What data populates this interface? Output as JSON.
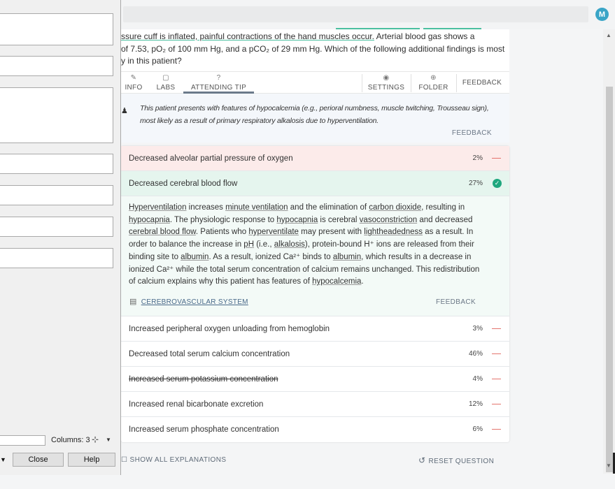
{
  "app": {
    "user_initial": "M",
    "accent": "#4bbfa0"
  },
  "stem": {
    "line1_a": "ssure cuff is inflated, painful contractions of the hand muscles occur.",
    "line1_b": " Arterial blood gas shows a",
    "line2": "of 7.53, pO₂ of 100 mm Hg, and a pCO₂ of 29 mm Hg. Which of the following additional findings is most",
    "line3": "y in this patient?"
  },
  "tabs": {
    "info": "INFO",
    "labs": "LABS",
    "attending_tip": "ATTENDING TIP",
    "settings": "SETTINGS",
    "folder": "FOLDER",
    "feedback": "FEEDBACK"
  },
  "tip": {
    "text": "This patient presents with features of hypocalcemia (e.g., perioral numbness, muscle twitching, Trousseau sign), most likely as a result of primary respiratory alkalosis due to hyperventilation.",
    "feedback": "FEEDBACK"
  },
  "answers": [
    {
      "text": "Decreased alveolar partial pressure of oxygen",
      "pct": "2%",
      "state": "wrong"
    },
    {
      "text": "Decreased cerebral blood flow",
      "pct": "27%",
      "state": "correct"
    },
    {
      "text": "Increased peripheral oxygen unloading from hemoglobin",
      "pct": "3%",
      "state": "neutral"
    },
    {
      "text": "Decreased total serum calcium concentration",
      "pct": "46%",
      "state": "neutral"
    },
    {
      "text": "Increased serum potassium concentration",
      "pct": "4%",
      "state": "struck"
    },
    {
      "text": "Increased renal bicarbonate excretion",
      "pct": "12%",
      "state": "neutral"
    },
    {
      "text": "Increased serum phosphate concentration",
      "pct": "6%",
      "state": "neutral"
    }
  ],
  "explanation": {
    "p1": "Hyperventilation",
    "p2": " increases ",
    "p3": "minute ventilation",
    "p4": " and the elimination of ",
    "p5": "carbon dioxide",
    "p6": ", resulting in ",
    "p7": "hypocapnia",
    "p8": ". The physiologic response to ",
    "p9": "hypocapnia",
    "p10": " is cerebral ",
    "p11": "vasoconstriction",
    "p12": " and decreased ",
    "p13": "cerebral blood flow",
    "p14": ". Patients who ",
    "p15": "hyperventilate",
    "p16": " may present with ",
    "p17": "lightheadedness",
    "p18": " as a result. In order to balance the increase in ",
    "p19": "pH",
    "p20": " (i.e., ",
    "p21": "alkalosis",
    "p22": "), protein-bound H⁺ ions are released from their binding site to ",
    "p23": "albumin",
    "p24": ". As a result, ionized Ca²⁺ binds to ",
    "p25": "albumin",
    "p26": ", which results in a decrease in ionized Ca²⁺ while the total serum concentration of calcium remains unchanged. This redistribution of calcium explains why this patient has features of ",
    "p27": "hypocalcemia",
    "p28": ".",
    "system_link": "CEREBROVASCULAR SYSTEM",
    "feedback": "FEEDBACK"
  },
  "bottom": {
    "show_all": "SHOW ALL EXPLANATIONS",
    "reset": "RESET QUESTION"
  },
  "dialog": {
    "columns_label": "Columns:",
    "columns_value": "3",
    "close": "Close",
    "help": "Help"
  }
}
